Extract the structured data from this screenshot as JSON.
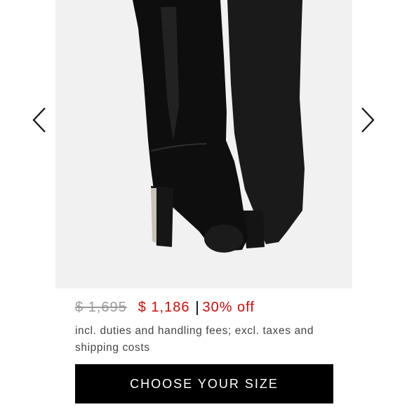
{
  "product": {
    "image_alt": "black leather knee-high boots with block heel",
    "original_price": "$ 1,695",
    "sale_price": "$ 1,186",
    "discount": "30% off",
    "fees_note": "incl. duties and handling fees; excl. taxes and shipping costs"
  },
  "actions": {
    "choose_size_label": "CHOOSE YOUR SIZE"
  },
  "icons": {
    "prev": "chevron-left-icon",
    "next": "chevron-right-icon"
  },
  "colors": {
    "sale": "#d20a0a",
    "strike": "#9a9a9a",
    "button_bg": "#000000",
    "image_bg": "#f1f1f1"
  }
}
